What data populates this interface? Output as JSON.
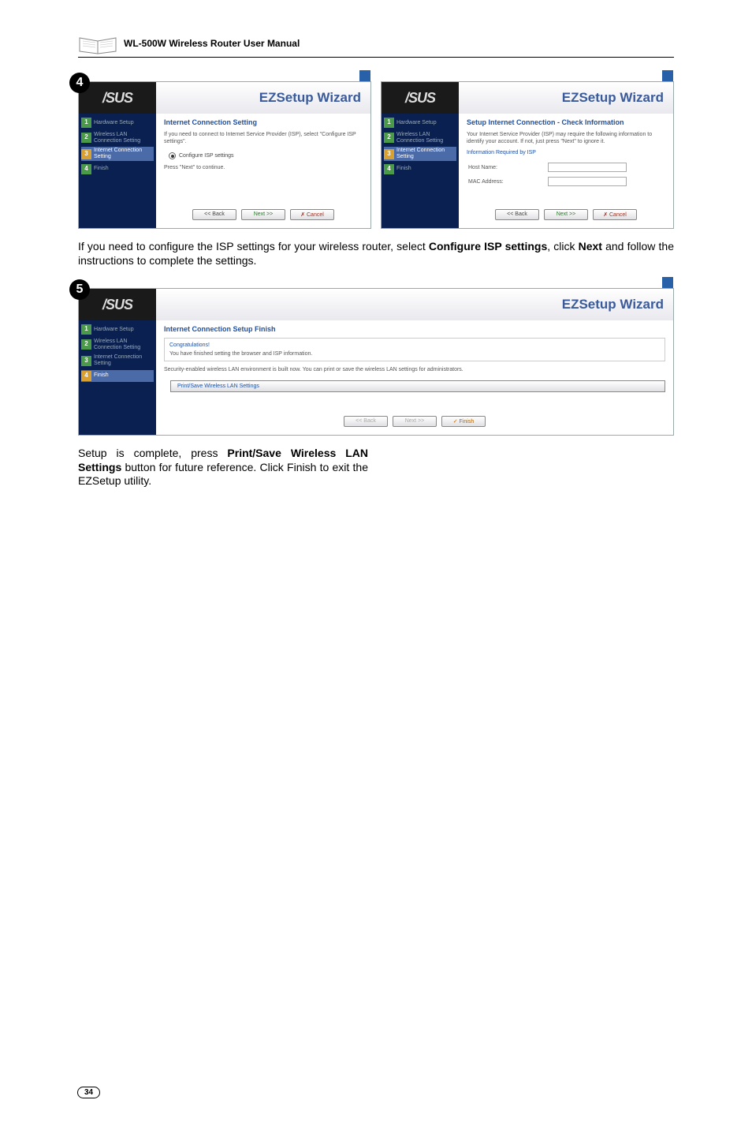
{
  "header": {
    "title": "WL-500W Wireless Router User Manual"
  },
  "step4": {
    "badge": "4",
    "logo": "/SUS",
    "wizard_title": "EZSetup Wizard",
    "sidebar": [
      {
        "num": "1",
        "label": "Hardware Setup"
      },
      {
        "num": "2",
        "label": "Wireless LAN Connection Setting"
      },
      {
        "num": "3",
        "label": "Internet Connection Setting"
      },
      {
        "num": "4",
        "label": "Finish"
      }
    ],
    "heading": "Internet Connection Setting",
    "text1": "If you need to connect to Internet Service Provider (ISP), select \"Configure ISP settings\".",
    "radio": "Configure ISP settings",
    "text2": "Press \"Next\" to continue.",
    "buttons": {
      "back": "<< Back",
      "next": "Next >>",
      "cancel": "✗ Cancel"
    }
  },
  "step4b": {
    "logo": "/SUS",
    "wizard_title": "EZSetup Wizard",
    "sidebar": [
      {
        "num": "1",
        "label": "Hardware Setup"
      },
      {
        "num": "2",
        "label": "Wireless LAN Connection Setting"
      },
      {
        "num": "3",
        "label": "Internet Connection Setting"
      },
      {
        "num": "4",
        "label": "Finish"
      }
    ],
    "heading": "Setup Internet Connection - Check Information",
    "text1": "Your Internet Service Provider (ISP) may require the following information to identify your account. If not, just press \"Next\" to ignore it.",
    "sub": "Information Required by ISP",
    "field1": "Host Name:",
    "field2": "MAC Address:",
    "buttons": {
      "back": "<< Back",
      "next": "Next >>",
      "cancel": "✗ Cancel"
    }
  },
  "caption4": "If you need to configure the ISP settings for your wireless router, select Configure ISP settings, click Next and follow the instructions to complete the settings.",
  "step5": {
    "badge": "5",
    "logo": "/SUS",
    "wizard_title": "EZSetup Wizard",
    "sidebar": [
      {
        "num": "1",
        "label": "Hardware Setup"
      },
      {
        "num": "2",
        "label": "Wireless LAN Connection Setting"
      },
      {
        "num": "3",
        "label": "Internet Connection Setting"
      },
      {
        "num": "4",
        "label": "Finish"
      }
    ],
    "heading": "Internet Connection Setup Finish",
    "congrats_title": "Congratulations!",
    "congrats_text": "You have finished setting the browser and ISP information.",
    "text2": "Security-enabled wireless LAN environment is built now. You can print or save the wireless LAN settings for administrators.",
    "ps_button": "Print/Save Wireless LAN Settings",
    "buttons": {
      "back": "<< Back",
      "next": "Next >>",
      "finish": "✓ Finish"
    }
  },
  "caption5": "Setup is complete, press Print/Save Wireless LAN Settings button for future reference. Click Finish to exit the EZSetup utility.",
  "page_number": "34"
}
